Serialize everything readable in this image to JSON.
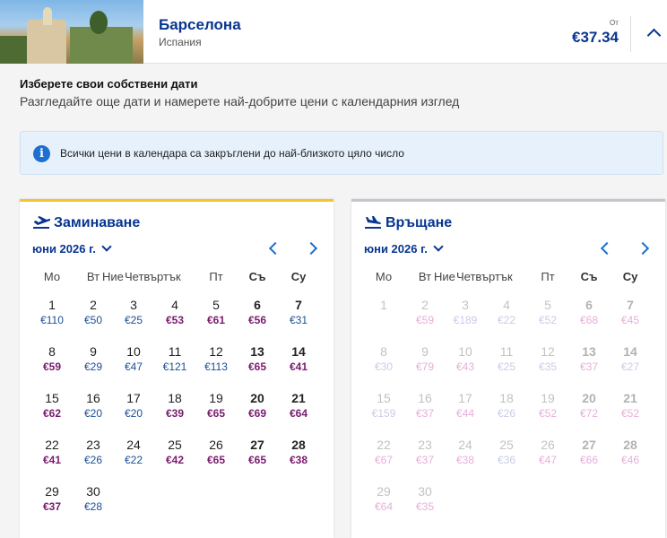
{
  "header": {
    "city": "Барселона",
    "country": "Испания",
    "from_label": "От",
    "price": "€37.34",
    "thumbnail": "barcelona-park-photo"
  },
  "intro": {
    "title": "Изберете свои собствени дати",
    "subtitle": "Разгледайте още дати и намерете най-добрите цени с календарния изглед"
  },
  "info_banner": {
    "icon": "info-icon",
    "text": "Всички цени в календара са закръглени до най-близкото цяло число"
  },
  "colors": {
    "brand": "#073590",
    "accent": "#f7c42e",
    "low_price": "#1a4f96",
    "high_price": "#7a1a6e"
  },
  "outbound": {
    "title": "Заминаване",
    "month": "юни 2026 г.",
    "weekdays": [
      "Мо",
      "Вт",
      "Ние",
      "Четвъртък",
      "Пт",
      "Съ",
      "Су"
    ],
    "days": [
      {
        "d": "1",
        "p": "€110",
        "t": "low"
      },
      {
        "d": "2",
        "p": "€50",
        "t": "low"
      },
      {
        "d": "3",
        "p": "€25",
        "t": "low"
      },
      {
        "d": "4",
        "p": "€53",
        "t": "high"
      },
      {
        "d": "5",
        "p": "€61",
        "t": "high"
      },
      {
        "d": "6",
        "p": "€56",
        "t": "high"
      },
      {
        "d": "7",
        "p": "€31",
        "t": "low"
      },
      {
        "d": "8",
        "p": "€59",
        "t": "high"
      },
      {
        "d": "9",
        "p": "€29",
        "t": "low"
      },
      {
        "d": "10",
        "p": "€47",
        "t": "low"
      },
      {
        "d": "11",
        "p": "€121",
        "t": "low"
      },
      {
        "d": "12",
        "p": "€113",
        "t": "low"
      },
      {
        "d": "13",
        "p": "€65",
        "t": "high"
      },
      {
        "d": "14",
        "p": "€41",
        "t": "high"
      },
      {
        "d": "15",
        "p": "€62",
        "t": "high"
      },
      {
        "d": "16",
        "p": "€20",
        "t": "low"
      },
      {
        "d": "17",
        "p": "€20",
        "t": "low"
      },
      {
        "d": "18",
        "p": "€39",
        "t": "high"
      },
      {
        "d": "19",
        "p": "€65",
        "t": "high"
      },
      {
        "d": "20",
        "p": "€69",
        "t": "high"
      },
      {
        "d": "21",
        "p": "€64",
        "t": "high"
      },
      {
        "d": "22",
        "p": "€41",
        "t": "high"
      },
      {
        "d": "23",
        "p": "€26",
        "t": "low"
      },
      {
        "d": "24",
        "p": "€22",
        "t": "low"
      },
      {
        "d": "25",
        "p": "€42",
        "t": "high"
      },
      {
        "d": "26",
        "p": "€65",
        "t": "high"
      },
      {
        "d": "27",
        "p": "€65",
        "t": "high"
      },
      {
        "d": "28",
        "p": "€38",
        "t": "high"
      },
      {
        "d": "29",
        "p": "€37",
        "t": "high"
      },
      {
        "d": "30",
        "p": "€28",
        "t": "low"
      }
    ]
  },
  "return": {
    "title": "Връщане",
    "month": "юни 2026 г.",
    "weekdays": [
      "Мо",
      "Вт",
      "Ние",
      "Четвъртък",
      "Пт",
      "Съ",
      "Су"
    ],
    "days": [
      {
        "d": "1",
        "p": "",
        "t": "low"
      },
      {
        "d": "2",
        "p": "€59",
        "t": "high"
      },
      {
        "d": "3",
        "p": "€189",
        "t": "low"
      },
      {
        "d": "4",
        "p": "€22",
        "t": "low"
      },
      {
        "d": "5",
        "p": "€52",
        "t": "low"
      },
      {
        "d": "6",
        "p": "€68",
        "t": "high"
      },
      {
        "d": "7",
        "p": "€45",
        "t": "high"
      },
      {
        "d": "8",
        "p": "€30",
        "t": "low"
      },
      {
        "d": "9",
        "p": "€79",
        "t": "high"
      },
      {
        "d": "10",
        "p": "€43",
        "t": "high"
      },
      {
        "d": "11",
        "p": "€25",
        "t": "low"
      },
      {
        "d": "12",
        "p": "€35",
        "t": "low"
      },
      {
        "d": "13",
        "p": "€37",
        "t": "high"
      },
      {
        "d": "14",
        "p": "€27",
        "t": "low"
      },
      {
        "d": "15",
        "p": "€159",
        "t": "low"
      },
      {
        "d": "16",
        "p": "€37",
        "t": "high"
      },
      {
        "d": "17",
        "p": "€44",
        "t": "high"
      },
      {
        "d": "18",
        "p": "€26",
        "t": "low"
      },
      {
        "d": "19",
        "p": "€52",
        "t": "high"
      },
      {
        "d": "20",
        "p": "€72",
        "t": "high"
      },
      {
        "d": "21",
        "p": "€52",
        "t": "high"
      },
      {
        "d": "22",
        "p": "€67",
        "t": "high"
      },
      {
        "d": "23",
        "p": "€37",
        "t": "high"
      },
      {
        "d": "24",
        "p": "€38",
        "t": "high"
      },
      {
        "d": "25",
        "p": "€36",
        "t": "low"
      },
      {
        "d": "26",
        "p": "€47",
        "t": "high"
      },
      {
        "d": "27",
        "p": "€66",
        "t": "high"
      },
      {
        "d": "28",
        "p": "€46",
        "t": "high"
      },
      {
        "d": "29",
        "p": "€64",
        "t": "high"
      },
      {
        "d": "30",
        "p": "€35",
        "t": "high"
      }
    ]
  }
}
